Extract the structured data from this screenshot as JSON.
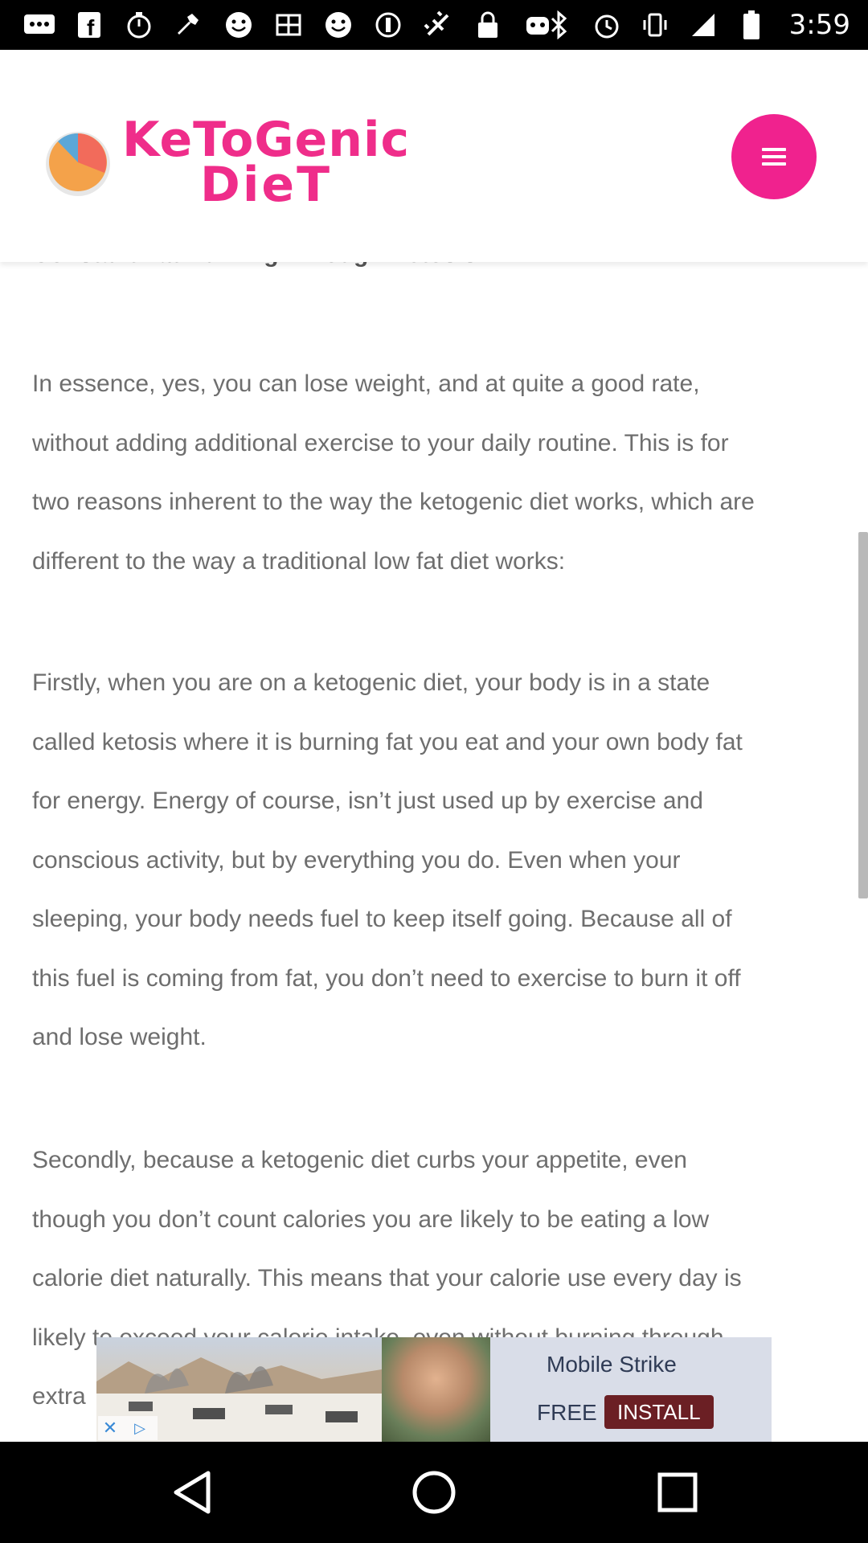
{
  "status_bar": {
    "time": "3:59",
    "left_icons": [
      "messages-icon",
      "facebook-icon",
      "timer-icon",
      "wrench-icon",
      "smiley-icon",
      "cn-app-icon",
      "smiley-icon",
      "circle-icon",
      "fake-gps-icon",
      "lock-icon",
      "game-icon"
    ],
    "right_icons": [
      "bluetooth-icon",
      "alarm-icon",
      "vibrate-icon",
      "signal-icon",
      "battery-icon"
    ]
  },
  "header": {
    "logo_line1": "KeToGenic",
    "logo_line2": "DieT",
    "menu_icon": "hamburger-menu-icon",
    "accent_color": "#f0228e"
  },
  "article": {
    "section_title": "Constant Fat Burning Through Ketosis",
    "paragraph1": [
      "In essence, yes, you can lose weight, and at quite a good rate,",
      "without adding additional exercise to your daily routine. This is for",
      "two reasons inherent to the way the ketogenic diet works, which are",
      "different to the way a traditional low fat diet works:"
    ],
    "paragraph2": [
      "Firstly, when you are on a ketogenic diet, your body is in a state",
      "called ketosis where it is burning fat you eat and your own body fat",
      "for energy. Energy of course, isn’t just used up by exercise and",
      "conscious activity, but by everything you do. Even when your",
      "sleeping, your body needs fuel to keep itself going. Because all of",
      "this fuel is coming from fat, you don’t need to exercise to burn it off",
      "and lose weight."
    ],
    "paragraph3": [
      "Secondly, because a ketogenic diet curbs your appetite, even",
      "though you don’t count calories you are likely to be eating a low",
      "calorie diet naturally. This means that your calorie use every day is",
      "likely to exceed your calorie intake, even without burning through",
      "extra"
    ]
  },
  "ad": {
    "title": "Mobile Strike",
    "free_label": "FREE",
    "install_label": "INSTALL",
    "close_icon": "close-icon",
    "adchoices_icon": "adchoices-icon"
  },
  "nav_bar": {
    "back_icon": "back-triangle-icon",
    "home_icon": "home-circle-icon",
    "recents_icon": "recents-square-icon"
  }
}
